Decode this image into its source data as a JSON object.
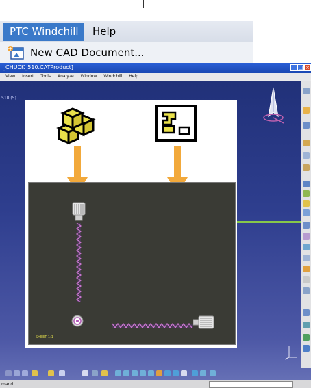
{
  "menu": {
    "windchill_label": "PTC Windchill",
    "help_label": "Help",
    "new_cad_label": "New CAD Document..."
  },
  "catia": {
    "title": "_CHUCK_510.CATProduct]",
    "menus": [
      "View",
      "Insert",
      "Tools",
      "Analyze",
      "Window",
      "Windchill",
      "Help"
    ],
    "tree_label": "510 (5)",
    "panel_label": "SHEET 1:1",
    "status_text": "mand"
  },
  "colors": {
    "menu_highlight": "#3a79c9",
    "viewport_dark": "#1f2f76",
    "drawing_bg": "#3a3b35",
    "arrow": "#f2a93b",
    "green_line": "#86c84a"
  }
}
